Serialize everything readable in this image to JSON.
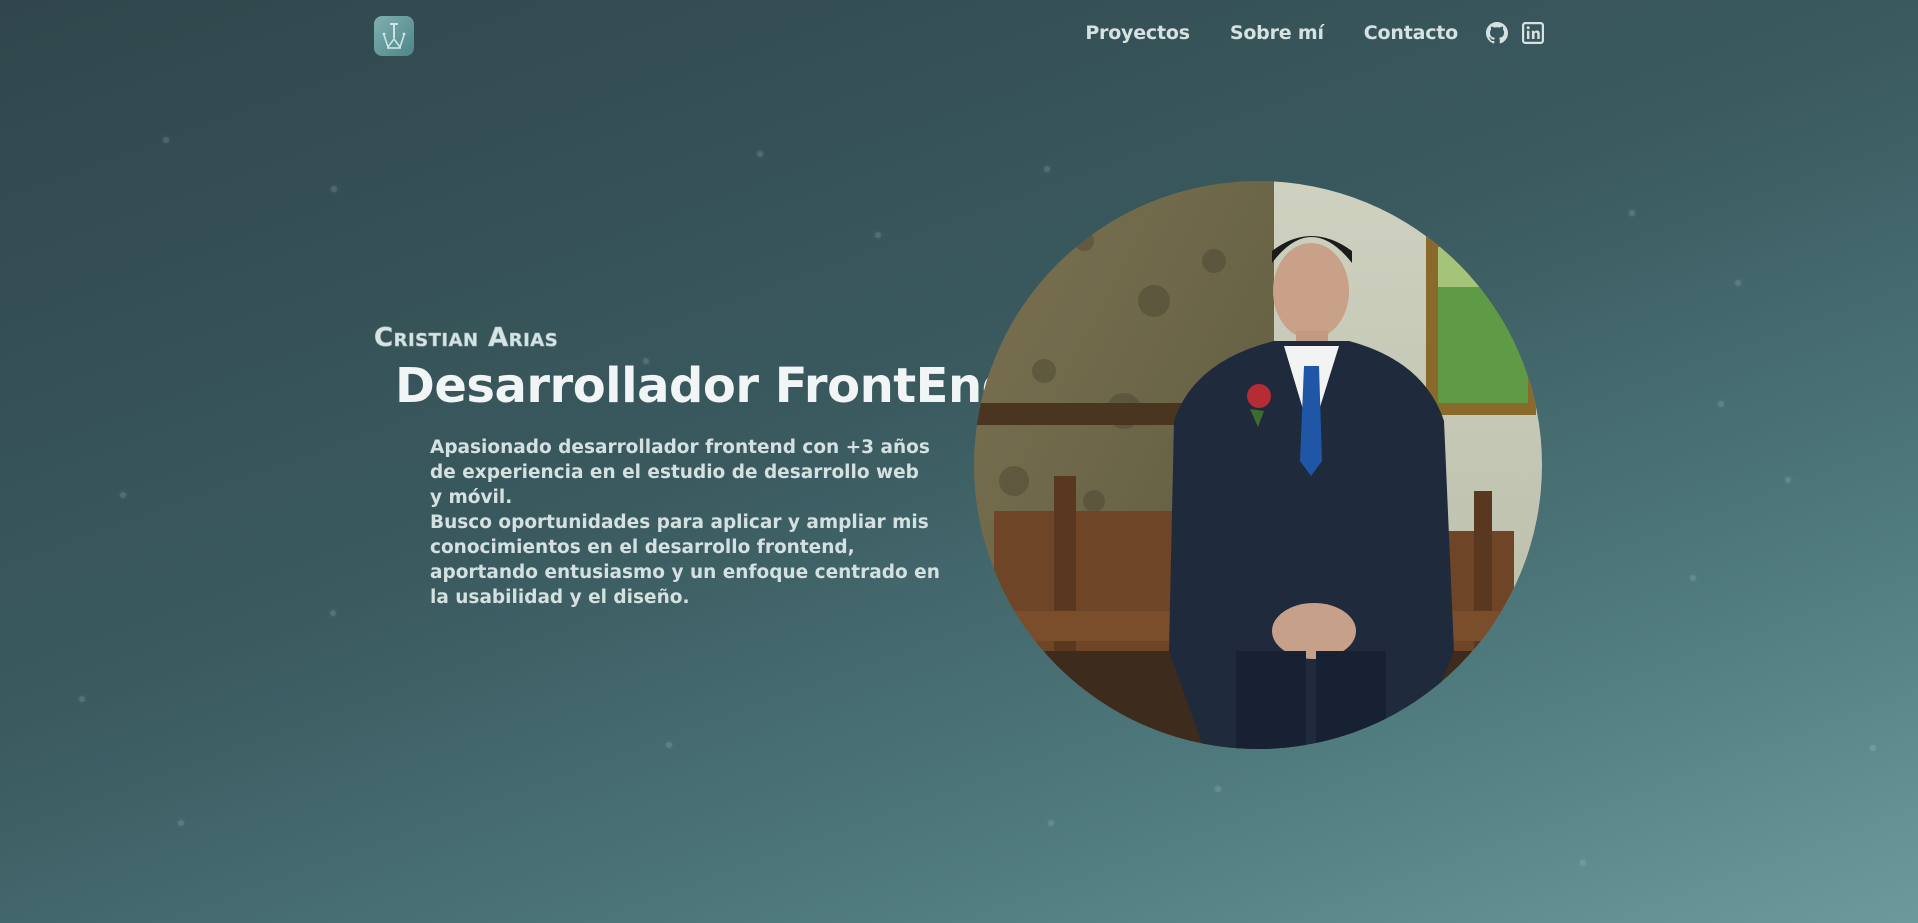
{
  "navbar": {
    "logo_icon": "crown-monogram-logo-icon",
    "links": [
      {
        "label": "Proyectos"
      },
      {
        "label": "Sobre mí"
      },
      {
        "label": "Contacto"
      }
    ],
    "icons": [
      "github-icon",
      "linkedin-icon"
    ]
  },
  "hero": {
    "name": "Cristian Arias",
    "title": "Desarrollador FrontEnd",
    "description": {
      "paragraph1": "Apasionado desarrollador frontend con +3 años\nde experiencia en el estudio de desarrollo web\ny móvil.",
      "paragraph2": "Busco oportunidades para aplicar y ampliar mis\nconocimientos en el desarrollo frontend,\naportando entusiasmo y un enfoque centrado en\nla usabilidad y el diseño."
    },
    "portrait_icon": "profile-photo"
  },
  "colors": {
    "background_start": "#30464c",
    "background_end": "#6c9a9c",
    "text_primary": "#f1f5f5",
    "text_secondary": "#d5e0e0",
    "logo_accent": "#7fb0b0"
  }
}
